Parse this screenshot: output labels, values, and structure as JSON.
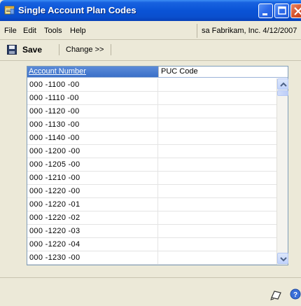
{
  "window": {
    "title": "Single Account Plan Codes",
    "icon": "app-window-icon",
    "controls": [
      "minimize-icon",
      "maximize-icon",
      "close-icon"
    ]
  },
  "menu": {
    "file": "File",
    "edit": "Edit",
    "tools": "Tools",
    "help": "Help",
    "user_info": "sa  Fabrikam, Inc.  4/12/2007"
  },
  "toolbar": {
    "save_label": "Save",
    "change_label": "Change >>"
  },
  "grid": {
    "columns": [
      "Account Number",
      "PUC Code"
    ],
    "rows": [
      {
        "account": "000 -1100 -00",
        "puc": ""
      },
      {
        "account": "000 -1110 -00",
        "puc": ""
      },
      {
        "account": "000 -1120 -00",
        "puc": ""
      },
      {
        "account": "000 -1130 -00",
        "puc": ""
      },
      {
        "account": "000 -1140 -00",
        "puc": ""
      },
      {
        "account": "000 -1200 -00",
        "puc": ""
      },
      {
        "account": "000 -1205 -00",
        "puc": ""
      },
      {
        "account": "000 -1210 -00",
        "puc": ""
      },
      {
        "account": "000 -1220 -00",
        "puc": ""
      },
      {
        "account": "000 -1220 -01",
        "puc": ""
      },
      {
        "account": "000 -1220 -02",
        "puc": ""
      },
      {
        "account": "000 -1220 -03",
        "puc": ""
      },
      {
        "account": "000 -1220 -04",
        "puc": ""
      },
      {
        "account": "000 -1230 -00",
        "puc": ""
      }
    ]
  },
  "colors": {
    "title_bar": "#0a53d6",
    "grid_header": "#3a6fc8",
    "window_bg": "#ece9d8"
  }
}
